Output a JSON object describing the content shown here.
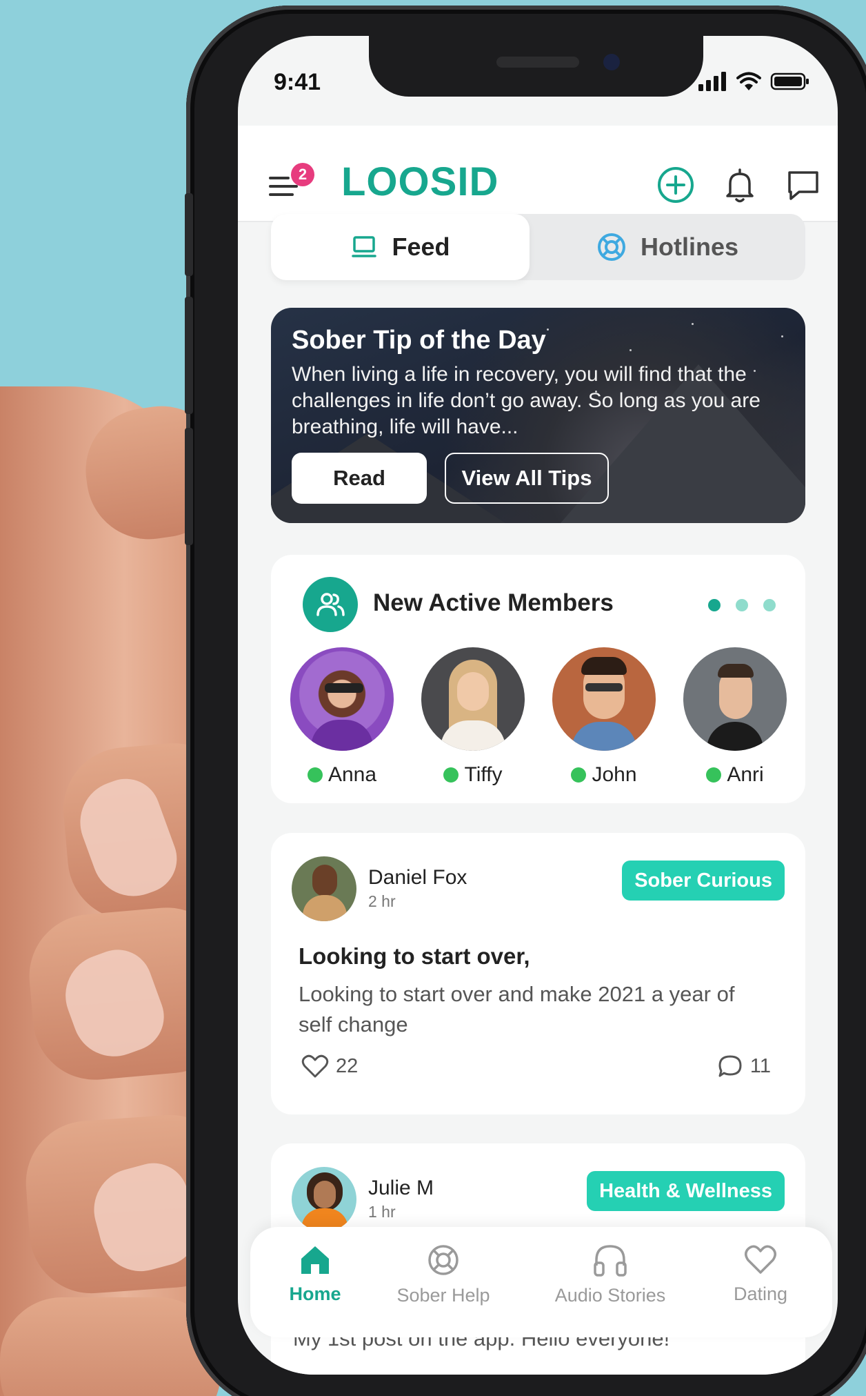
{
  "status_bar": {
    "time": "9:41"
  },
  "header": {
    "logo": "LOOSID",
    "menu_badge": "2"
  },
  "tabs": [
    {
      "label": "Feed",
      "icon": "laptop-icon",
      "active": true
    },
    {
      "label": "Hotlines",
      "icon": "lifebuoy-icon",
      "active": false
    }
  ],
  "tip": {
    "title": "Sober Tip of the Day",
    "text": "When living a life in recovery, you will find that the challenges in life don’t go away. So long as you are breathing, life will have...",
    "read_label": "Read",
    "view_all_label": "View All Tips"
  },
  "members": {
    "title": "New Active Members",
    "list": [
      {
        "name": "Anna"
      },
      {
        "name": "Tiffy"
      },
      {
        "name": "John"
      },
      {
        "name": "Anri"
      }
    ]
  },
  "posts": [
    {
      "author": "Daniel Fox",
      "time": "2 hr",
      "tag": "Sober Curious",
      "title": "Looking to start over,",
      "body": "Looking to start over and make 2021 a year of self change",
      "likes": "22",
      "comments": "11"
    },
    {
      "author": "Julie M",
      "time": "1 hr",
      "tag": "Health & Wellness",
      "body_peek": "My 1st post on the app. Hello everyone!"
    }
  ],
  "bottom_nav": [
    {
      "label": "Home",
      "icon": "home-icon",
      "active": true
    },
    {
      "label": "Sober Help",
      "icon": "lifebuoy-icon",
      "active": false
    },
    {
      "label": "Audio Stories",
      "icon": "headphones-icon",
      "active": false
    },
    {
      "label": "Dating",
      "icon": "heart-icon",
      "active": false
    }
  ],
  "colors": {
    "brand": "#17a78e",
    "tag": "#25d0b3",
    "badge": "#e73c7e",
    "online": "#36c25b",
    "background": "#8ed0db"
  }
}
